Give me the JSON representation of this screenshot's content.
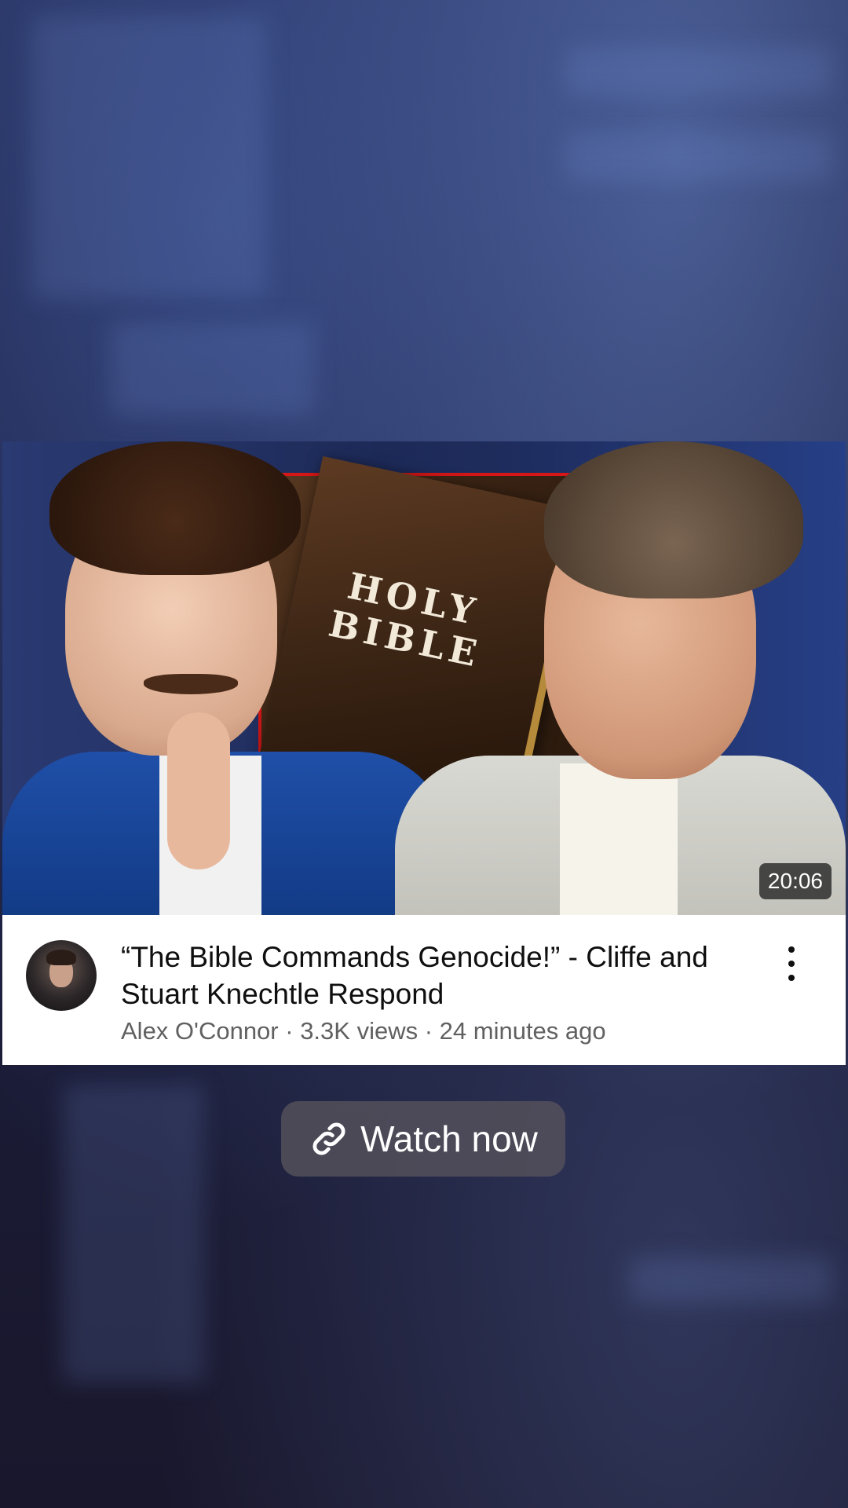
{
  "video": {
    "duration": "20:06",
    "thumbnail_text": "HOLY BIBLE",
    "title": "“The Bible Commands Genocide!” - Cliffe and Stuart Knechtle Respond",
    "channel": "Alex O'Connor",
    "views": "3.3K views",
    "age": "24 minutes ago",
    "separator": " · "
  },
  "watch_button": {
    "label": "Watch now",
    "icon": "link-icon"
  },
  "menu": {
    "icon": "more-vertical-icon"
  }
}
